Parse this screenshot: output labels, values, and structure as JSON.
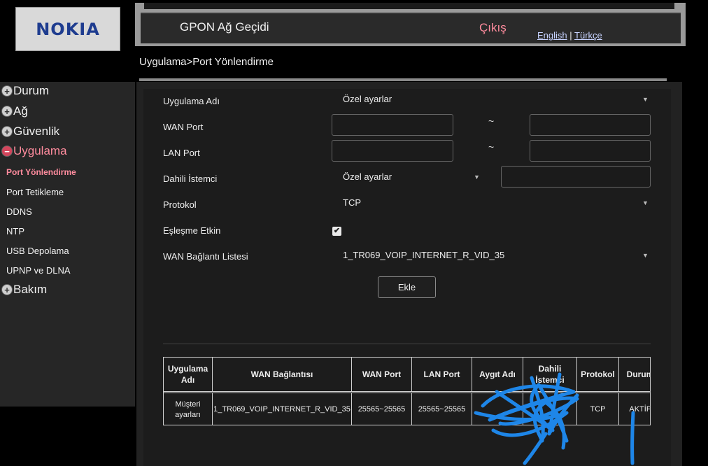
{
  "header": {
    "logo_text": "NOKIA",
    "title": "GPON Ağ Geçidi",
    "logout": "Çıkış",
    "lang_english": "English",
    "lang_sep": "|",
    "lang_turkish": "Türkçe"
  },
  "breadcrumb": "Uygulama>Port Yönlendirme",
  "sidebar": {
    "categories": [
      {
        "label": "Durum",
        "icon": "plus-circle-icon"
      },
      {
        "label": "Ağ",
        "icon": "plus-circle-icon"
      },
      {
        "label": "Güvenlik",
        "icon": "plus-circle-icon"
      },
      {
        "label": "Uygulama",
        "icon": "minus-circle-icon"
      },
      {
        "label": "Bakım",
        "icon": "plus-circle-icon"
      }
    ],
    "subitems": [
      "Port Yönlendirme",
      "Port Tetikleme",
      "DDNS",
      "NTP",
      "USB Depolama",
      "UPNP ve DLNA"
    ]
  },
  "form": {
    "app_name_label": "Uygulama Adı",
    "app_name_value": "Özel ayarlar",
    "wan_port_label": "WAN Port",
    "lan_port_label": "LAN Port",
    "internal_client_label": "Dahili İstemci",
    "internal_client_value": "Özel ayarlar",
    "protocol_label": "Protokol",
    "protocol_value": "TCP",
    "enable_label": "Eşleşme Etkin",
    "enable_checked": "✔",
    "wan_list_label": "WAN Bağlantı Listesi",
    "wan_list_value": "1_TR069_VOIP_INTERNET_R_VID_35",
    "range_sep": "~",
    "add_button": "Ekle"
  },
  "table": {
    "headers": [
      "Uygulama Adı",
      "WAN Bağlantısı",
      "WAN Port",
      "LAN Port",
      "Aygıt Adı",
      "Dahili İstemci",
      "Protokol",
      "Durum"
    ],
    "rows": [
      [
        "Müşteri ayarları",
        "1_TR069_VOIP_INTERNET_R_VID_35",
        "25565~25565",
        "25565~25565",
        "",
        "",
        "TCP",
        "AKTİF"
      ]
    ]
  },
  "colors": {
    "accent_pink": "#ff8c9e",
    "logo_blue": "#1e3c8f",
    "scribble_blue": "#1e86e8"
  }
}
